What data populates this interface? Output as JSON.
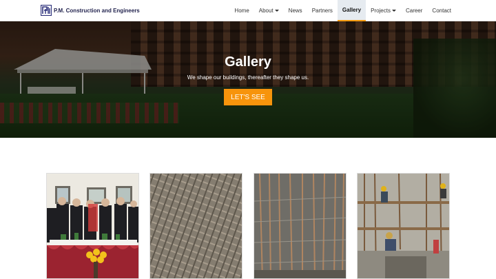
{
  "brand": {
    "name": "P.M. Construction and Engineers",
    "logo_icon": "pm-logo-icon"
  },
  "nav": {
    "items": [
      {
        "label": "Home",
        "dropdown": false,
        "active": false
      },
      {
        "label": "About",
        "dropdown": true,
        "active": false
      },
      {
        "label": "News",
        "dropdown": false,
        "active": false
      },
      {
        "label": "Partners",
        "dropdown": false,
        "active": false
      },
      {
        "label": "Gallery",
        "dropdown": false,
        "active": true
      },
      {
        "label": "Projects",
        "dropdown": true,
        "active": false
      },
      {
        "label": "Career",
        "dropdown": false,
        "active": false
      },
      {
        "label": "Contact",
        "dropdown": false,
        "active": false
      }
    ]
  },
  "hero": {
    "title": "Gallery",
    "subtitle": "We shape our buildings, thereafter they shape us.",
    "button_label": "LET'S SEE"
  },
  "colors": {
    "accent": "#f7940c",
    "brand_text": "#23244f",
    "active_nav_bg": "#e6ebf0"
  }
}
